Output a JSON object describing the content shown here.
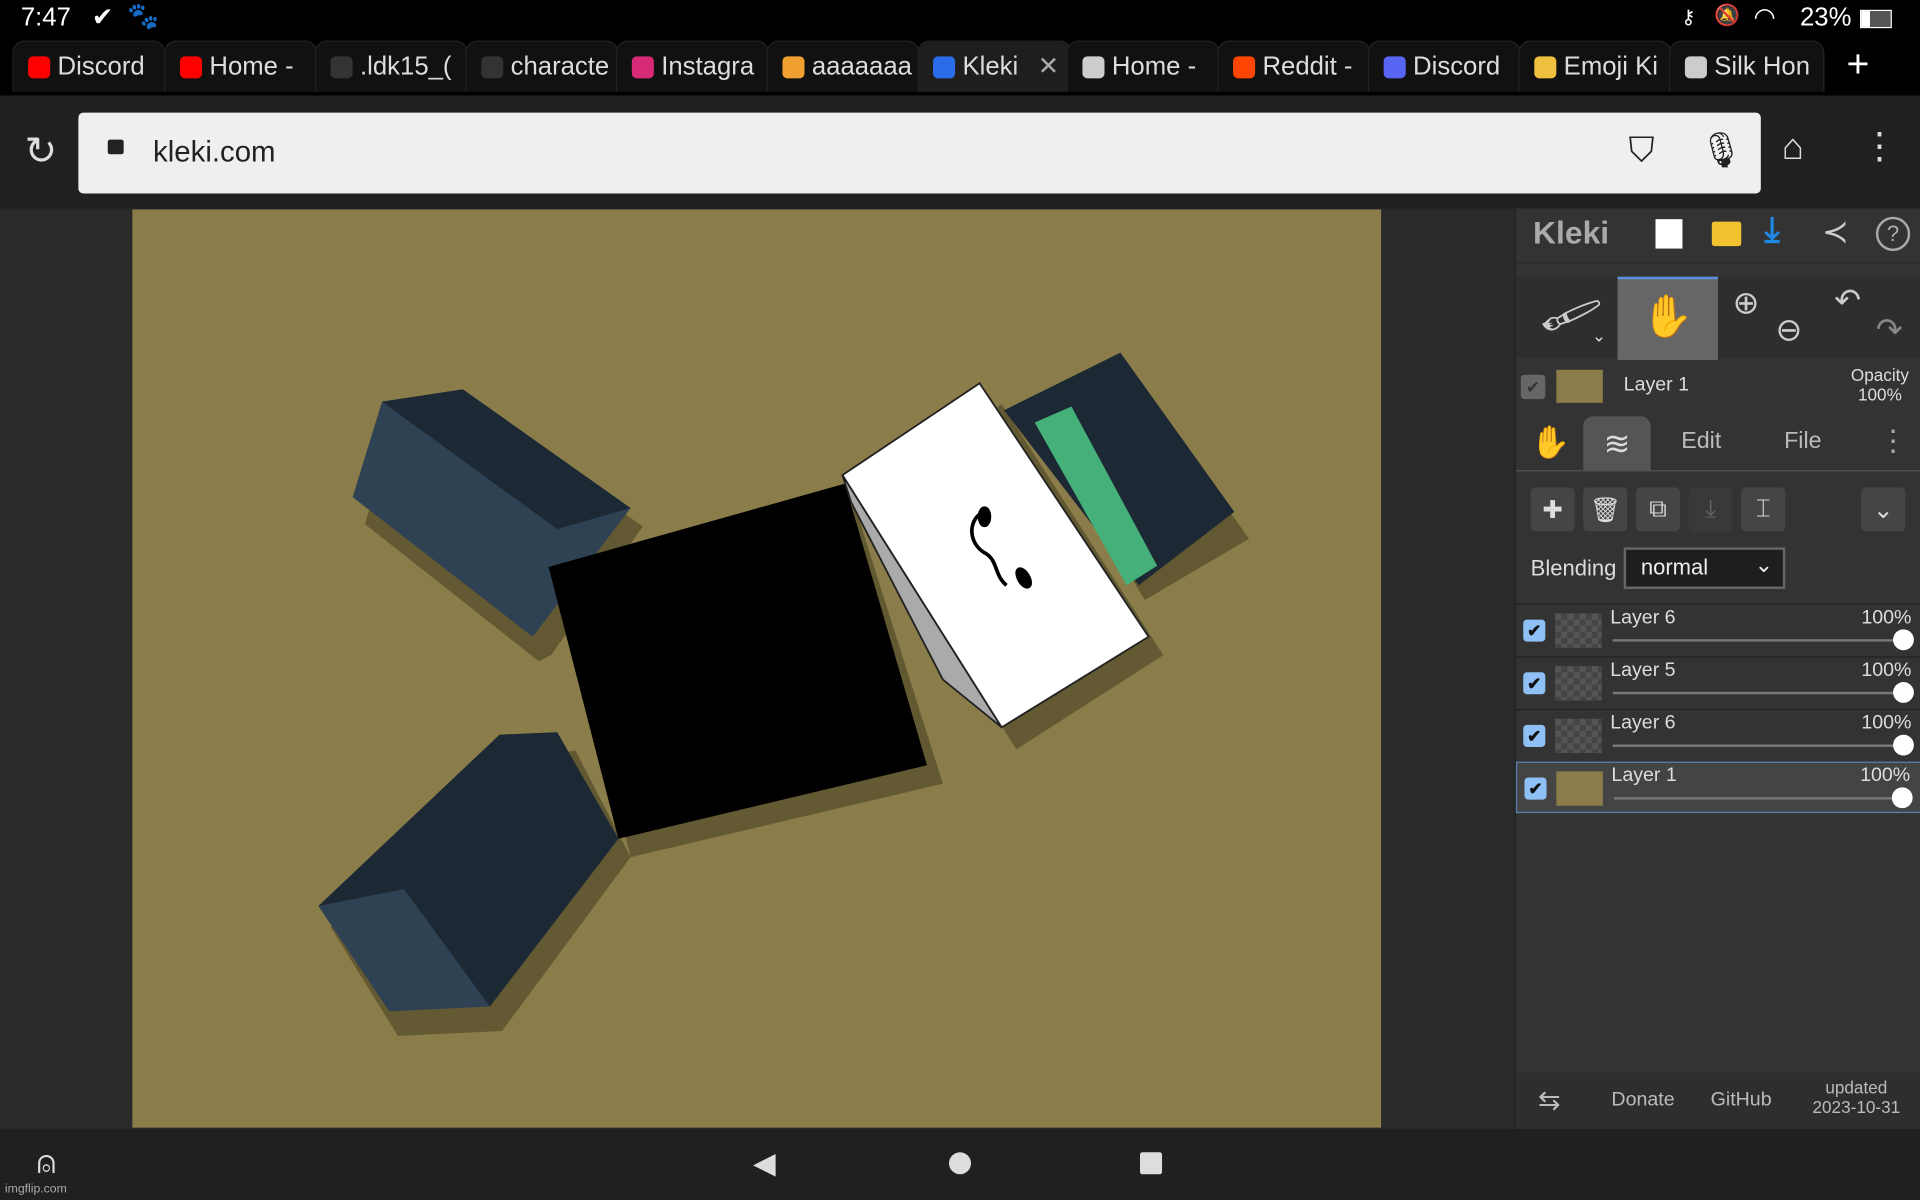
{
  "status_bar": {
    "time": "7:47",
    "battery": "23%"
  },
  "tabs": [
    {
      "label": "Discord",
      "icon": "youtube-icon",
      "color": "#ff0000"
    },
    {
      "label": "Home -",
      "icon": "youtube-icon",
      "color": "#ff0000"
    },
    {
      "label": ".ldk15_(",
      "icon": "imgflip-icon",
      "color": "#333333"
    },
    {
      "label": "characte",
      "icon": "character-ai-icon",
      "color": "#333333"
    },
    {
      "label": "Instagra",
      "icon": "instagram-icon",
      "color": "#d62976"
    },
    {
      "label": "aaaaaaa",
      "icon": "app-icon",
      "color": "#f0a030"
    },
    {
      "label": "Kleki",
      "icon": "kleki-icon",
      "color": "#2b6de8",
      "active": true
    },
    {
      "label": "Home -",
      "icon": "roblox-icon",
      "color": "#cccccc"
    },
    {
      "label": "Reddit -",
      "icon": "reddit-icon",
      "color": "#ff4500"
    },
    {
      "label": "Discord",
      "icon": "discord-icon",
      "color": "#5865f2"
    },
    {
      "label": "Emoji Ki",
      "icon": "emoji-kitchen-icon",
      "color": "#f0c040"
    },
    {
      "label": "Silk Hon",
      "icon": "globe-icon",
      "color": "#cccccc"
    }
  ],
  "address_bar": {
    "url": "kleki.com"
  },
  "kleki": {
    "logo": "Kleki",
    "current_layer": {
      "name": "Layer 1",
      "opacity_label": "Opacity",
      "opacity": "100%"
    },
    "tabs": {
      "edit": "Edit",
      "file": "File"
    },
    "blending_label": "Blending",
    "blending_value": "normal",
    "layers": [
      {
        "name": "Layer 6",
        "opacity": "100%",
        "visible": true
      },
      {
        "name": "Layer 5",
        "opacity": "100%",
        "visible": true
      },
      {
        "name": "Layer 6",
        "opacity": "100%",
        "visible": true
      },
      {
        "name": "Layer 1",
        "opacity": "100%",
        "visible": true,
        "selected": true
      }
    ],
    "footer": {
      "donate": "Donate",
      "github": "GitHub",
      "updated": "updated",
      "date": "2023-10-31"
    },
    "canvas_color": "#8a7d4a"
  },
  "watermark": "imgflip.com"
}
